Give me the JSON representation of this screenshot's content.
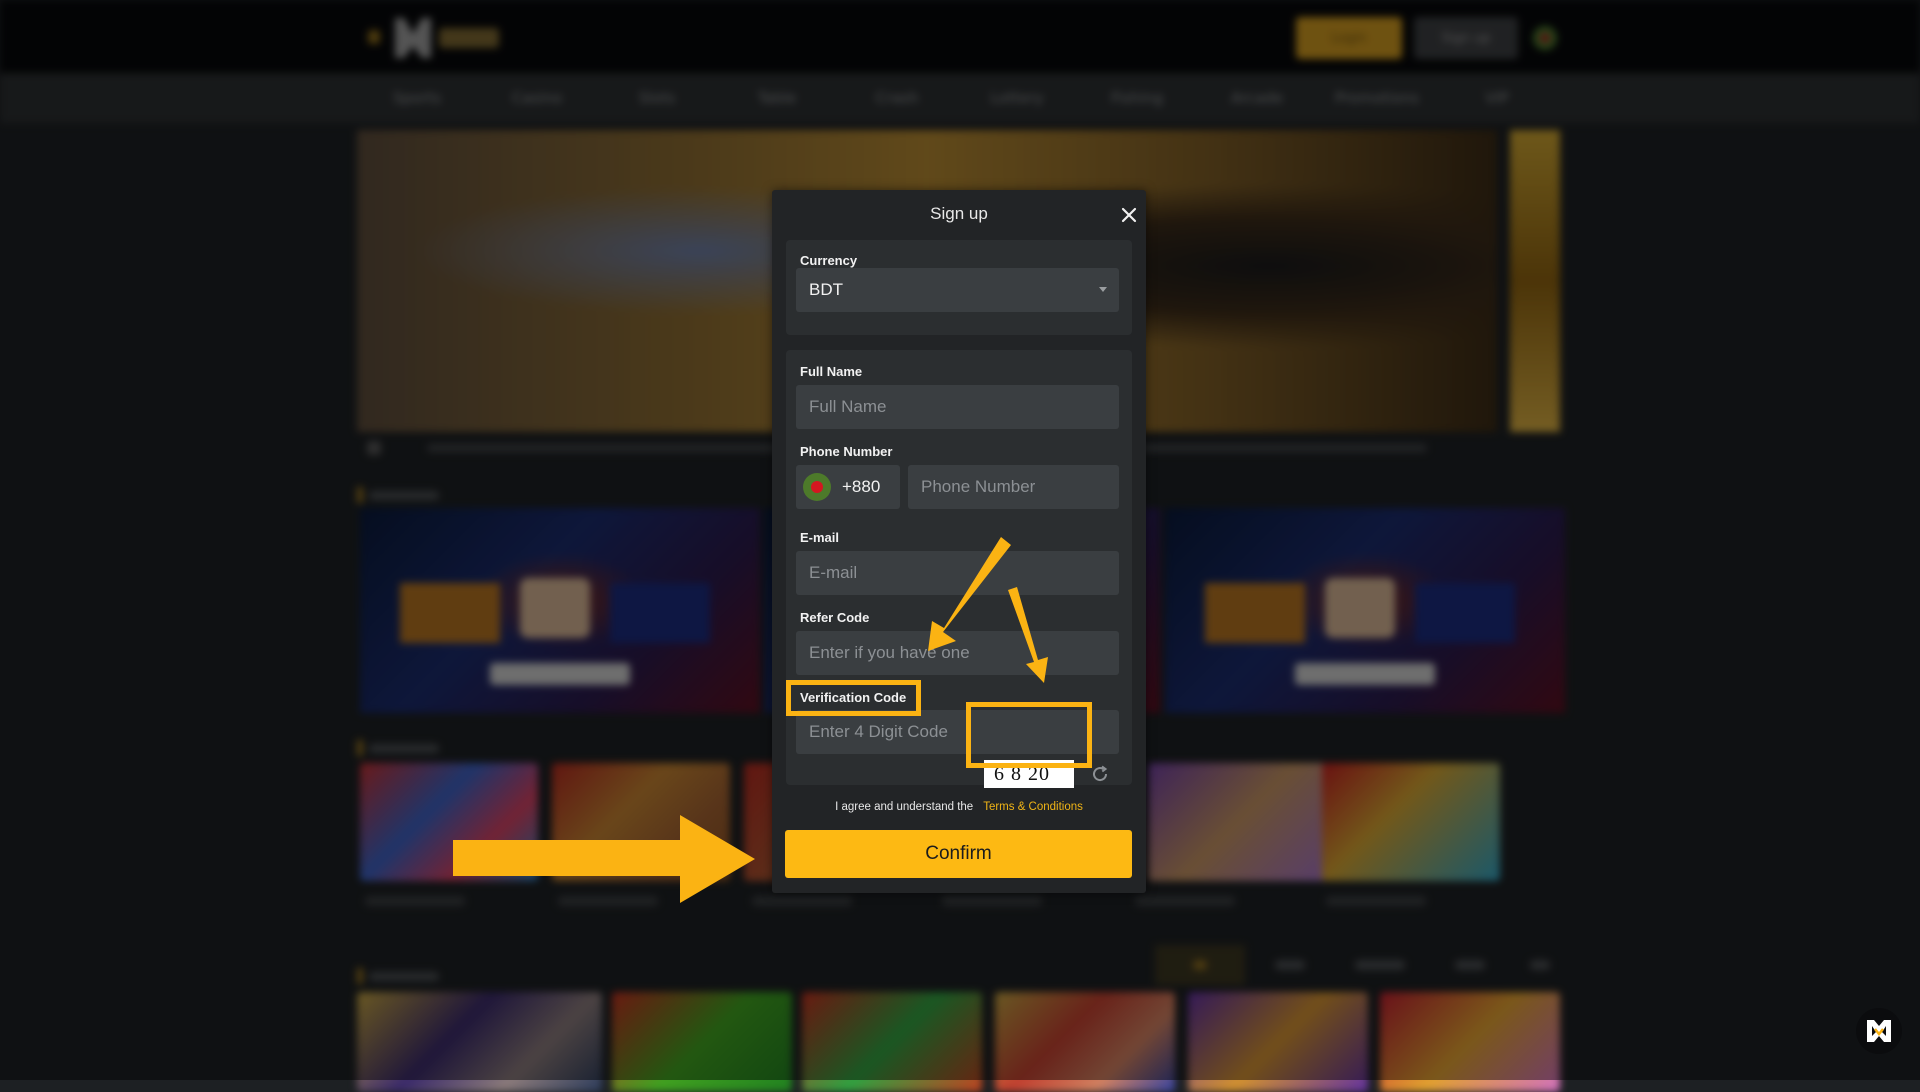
{
  "header": {
    "login_label": "Login",
    "signup_label": "Sign up",
    "nav": [
      "Sports",
      "Casino",
      "Slots",
      "Table",
      "Crash",
      "Lottery",
      "Fishing",
      "Arcade",
      "Promotions",
      "VIP"
    ]
  },
  "modal": {
    "title": "Sign up",
    "currency": {
      "label": "Currency",
      "value": "BDT"
    },
    "full_name": {
      "label": "Full Name",
      "placeholder": "Full Name",
      "value": ""
    },
    "phone": {
      "label": "Phone Number",
      "country_code": "+880",
      "placeholder": "Phone Number",
      "value": ""
    },
    "email": {
      "label": "E-mail",
      "placeholder": "E-mail",
      "value": ""
    },
    "refer_code": {
      "label": "Refer Code",
      "placeholder": "Enter if you have one",
      "value": ""
    },
    "verification": {
      "label": "Verification Code",
      "placeholder": "Enter 4 Digit Code",
      "value": "",
      "captcha": "6 8 20"
    },
    "terms_text": "I agree and understand the",
    "terms_link": "Terms & Conditions",
    "confirm_label": "Confirm"
  },
  "colors": {
    "accent": "#fdb913",
    "annotation": "#fbb313",
    "modal_bg": "#222426",
    "input_bg": "#3a3e41"
  }
}
